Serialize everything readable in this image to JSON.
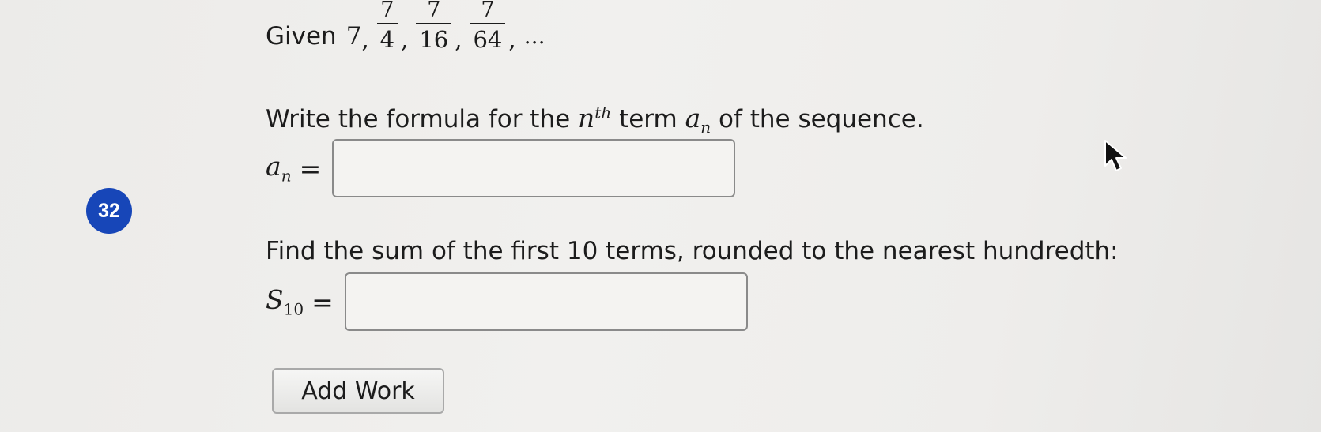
{
  "question": {
    "number": "32",
    "given_label": "Given",
    "first_term": "7",
    "terms": [
      {
        "numerator": "7",
        "denominator": "4"
      },
      {
        "numerator": "7",
        "denominator": "16"
      },
      {
        "numerator": "7",
        "denominator": "64"
      }
    ],
    "separator": ",",
    "ellipsis": "…",
    "part1": {
      "prompt_before": "Write the formula for the",
      "n_symbol": "n",
      "superscript": "th",
      "prompt_middle": "term",
      "a_symbol": "a",
      "subscript": "n",
      "prompt_after": "of the sequence.",
      "answer_label_main": "a",
      "answer_label_sub": "n",
      "equals": "=",
      "answer_value": ""
    },
    "part2": {
      "prompt": "Find the sum of the first 10 terms, rounded to the nearest hundredth:",
      "answer_label_main": "S",
      "answer_label_sub": "10",
      "equals": "=",
      "answer_value": ""
    },
    "add_work_label": "Add Work"
  },
  "colors": {
    "badge": "#1746b8",
    "badge_text": "#ffffff",
    "text": "#1c1c1c",
    "input_border": "#8a8a8a"
  },
  "icons": {
    "cursor": "mouse-pointer-icon"
  }
}
